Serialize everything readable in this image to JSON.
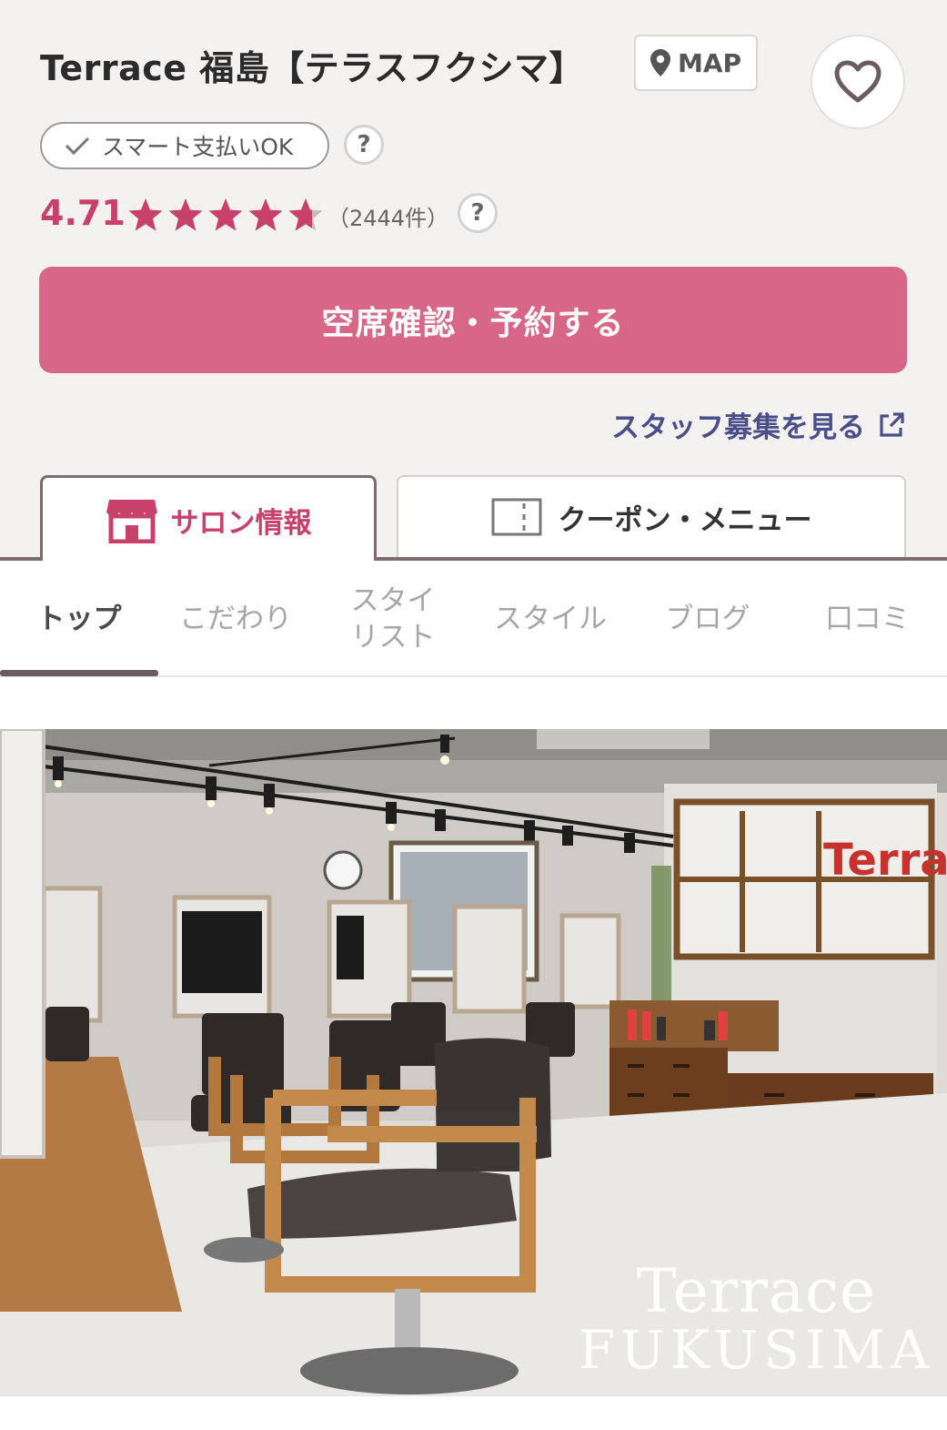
{
  "salon": {
    "name": "Terrace 福島【テラスフクシマ】",
    "map_label": "MAP",
    "smart_pay_label": "スマート支払いOK",
    "help_mark": "?",
    "rating": "4.71",
    "rating_value": 4.71,
    "review_count": "（2444件）",
    "reserve_label": "空席確認・予約する",
    "staff_link_label": "スタッフ募集を見る"
  },
  "tabs": {
    "salon_info": "サロン情報",
    "coupon_menu": "クーポン・メニュー"
  },
  "subnav": {
    "items": [
      "トップ",
      "こだわり",
      "スタイリスト",
      "スタイル",
      "ブログ",
      "口コミ"
    ],
    "stylist_line1": "スタイ",
    "stylist_line2": "リスト",
    "active": "トップ"
  },
  "photo": {
    "watermark_line1": "Terrace",
    "watermark_line2": "FUKUSIMA",
    "sign_text": "Terrace"
  },
  "colors": {
    "accent": "#d86686",
    "rating": "#c8416b",
    "link": "#4a4f8a",
    "header_bg": "#f4f2f1"
  },
  "icons": {
    "map": "map-pin-icon",
    "favorite": "heart-icon",
    "smart_pay": "check-icon",
    "help": "question-icon",
    "external": "external-link-icon",
    "salon_tab": "shop-icon",
    "coupon_tab": "ticket-icon"
  }
}
